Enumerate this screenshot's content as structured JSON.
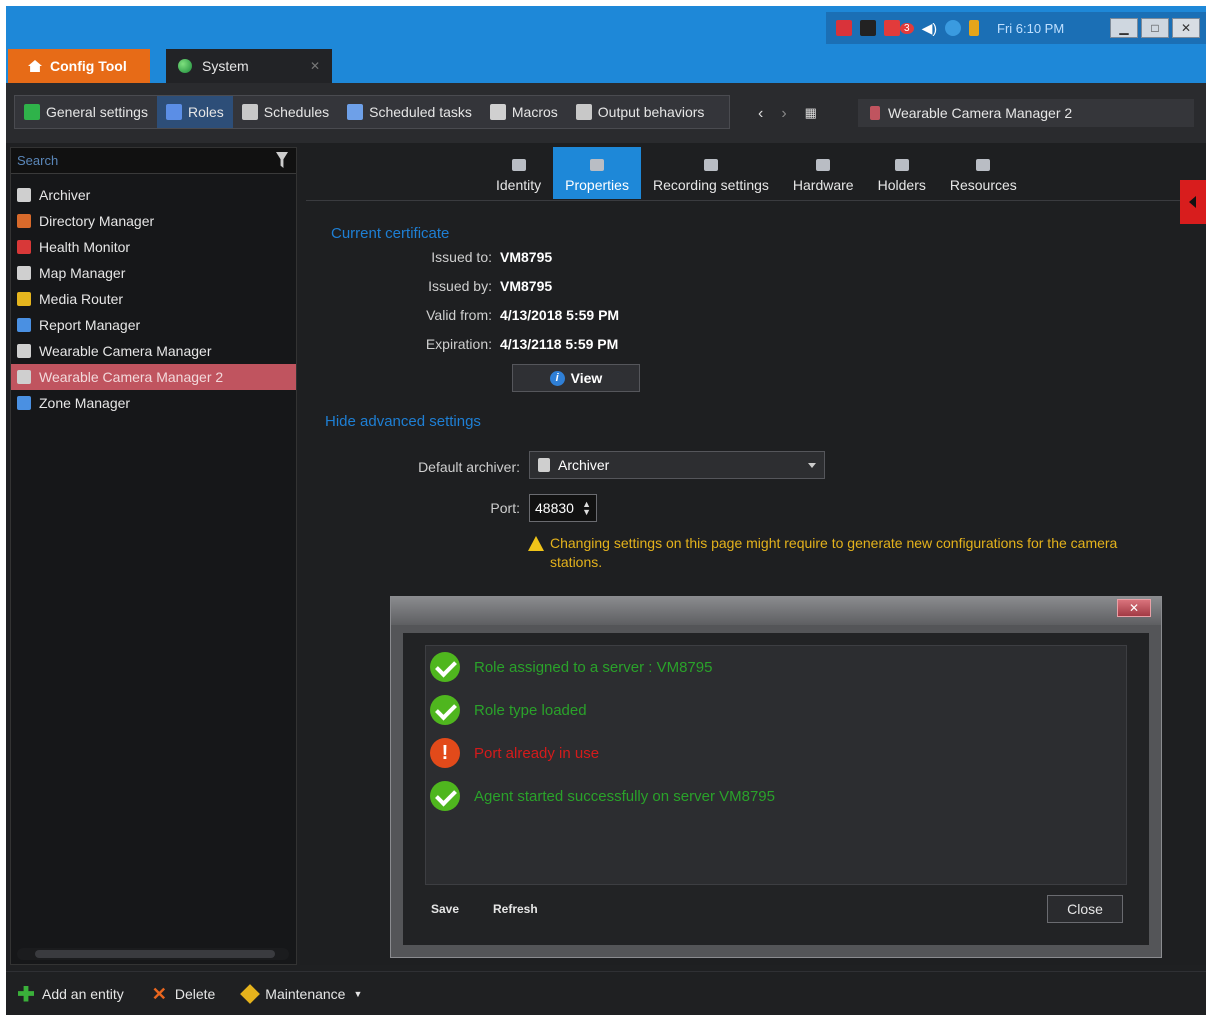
{
  "tray": {
    "clock": "Fri 6:10 PM",
    "notification_count": "3"
  },
  "tabs": {
    "config": "Config Tool",
    "system": "System"
  },
  "toolbar": [
    {
      "label": "General settings",
      "icon": "globe-icon",
      "color": "#2fb34a"
    },
    {
      "label": "Roles",
      "icon": "roles-icon",
      "color": "#5b8ee6",
      "active": true
    },
    {
      "label": "Schedules",
      "icon": "calendar-icon",
      "color": "#c8c8c8"
    },
    {
      "label": "Scheduled tasks",
      "icon": "task-icon",
      "color": "#6ea0e8"
    },
    {
      "label": "Macros",
      "icon": "macro-icon",
      "color": "#d0d0d0"
    },
    {
      "label": "Output behaviors",
      "icon": "output-icon",
      "color": "#c8c8c8"
    }
  ],
  "breadcrumb": "Wearable Camera Manager 2",
  "search": {
    "placeholder": "Search"
  },
  "tree": [
    {
      "label": "Archiver",
      "icon": "archiver-icon",
      "color": "#cfcfcf"
    },
    {
      "label": "Directory Manager",
      "icon": "directory-icon",
      "color": "#d86a2b"
    },
    {
      "label": "Health Monitor",
      "icon": "health-icon",
      "color": "#d83838"
    },
    {
      "label": "Map Manager",
      "icon": "map-icon",
      "color": "#cfcfcf"
    },
    {
      "label": "Media Router",
      "icon": "router-icon",
      "color": "#e5b51e"
    },
    {
      "label": "Report Manager",
      "icon": "report-icon",
      "color": "#4a90e2"
    },
    {
      "label": "Wearable Camera Manager",
      "icon": "camera-icon",
      "color": "#cfcfcf"
    },
    {
      "label": "Wearable Camera Manager 2",
      "icon": "camera-icon",
      "color": "#cfcfcf",
      "selected": true
    },
    {
      "label": "Zone Manager",
      "icon": "zone-icon",
      "color": "#4a90e2"
    }
  ],
  "subtabs": [
    {
      "label": "Identity",
      "icon": "identity-icon"
    },
    {
      "label": "Properties",
      "icon": "properties-icon",
      "active": true
    },
    {
      "label": "Recording settings",
      "icon": "recording-icon"
    },
    {
      "label": "Hardware",
      "icon": "hardware-icon"
    },
    {
      "label": "Holders",
      "icon": "holders-icon"
    },
    {
      "label": "Resources",
      "icon": "resources-icon"
    }
  ],
  "certificate": {
    "title": "Current certificate",
    "rows": [
      {
        "key": "Issued to:",
        "value": "VM8795"
      },
      {
        "key": "Issued by:",
        "value": "VM8795"
      },
      {
        "key": "Valid from:",
        "value": "4/13/2018 5:59 PM"
      },
      {
        "key": "Expiration:",
        "value": "4/13/2118 5:59 PM"
      }
    ],
    "view_label": "View"
  },
  "advanced": {
    "toggle": "Hide advanced settings",
    "archiver_label": "Default archiver:",
    "archiver_value": "Archiver",
    "port_label": "Port:",
    "port_value": "48830",
    "warning": "Changing settings on this page might require to generate new configurations for the camera stations."
  },
  "dialog": {
    "messages": [
      {
        "text": "Role assigned to a server : VM8795",
        "status": "ok"
      },
      {
        "text": "Role type loaded",
        "status": "ok"
      },
      {
        "text": "Port already in use",
        "status": "error"
      },
      {
        "text": "Agent started successfully on server VM8795",
        "status": "ok"
      }
    ],
    "save": "Save",
    "refresh": "Refresh",
    "close": "Close"
  },
  "bottom": {
    "add": "Add an entity",
    "delete": "Delete",
    "maintenance": "Maintenance"
  }
}
